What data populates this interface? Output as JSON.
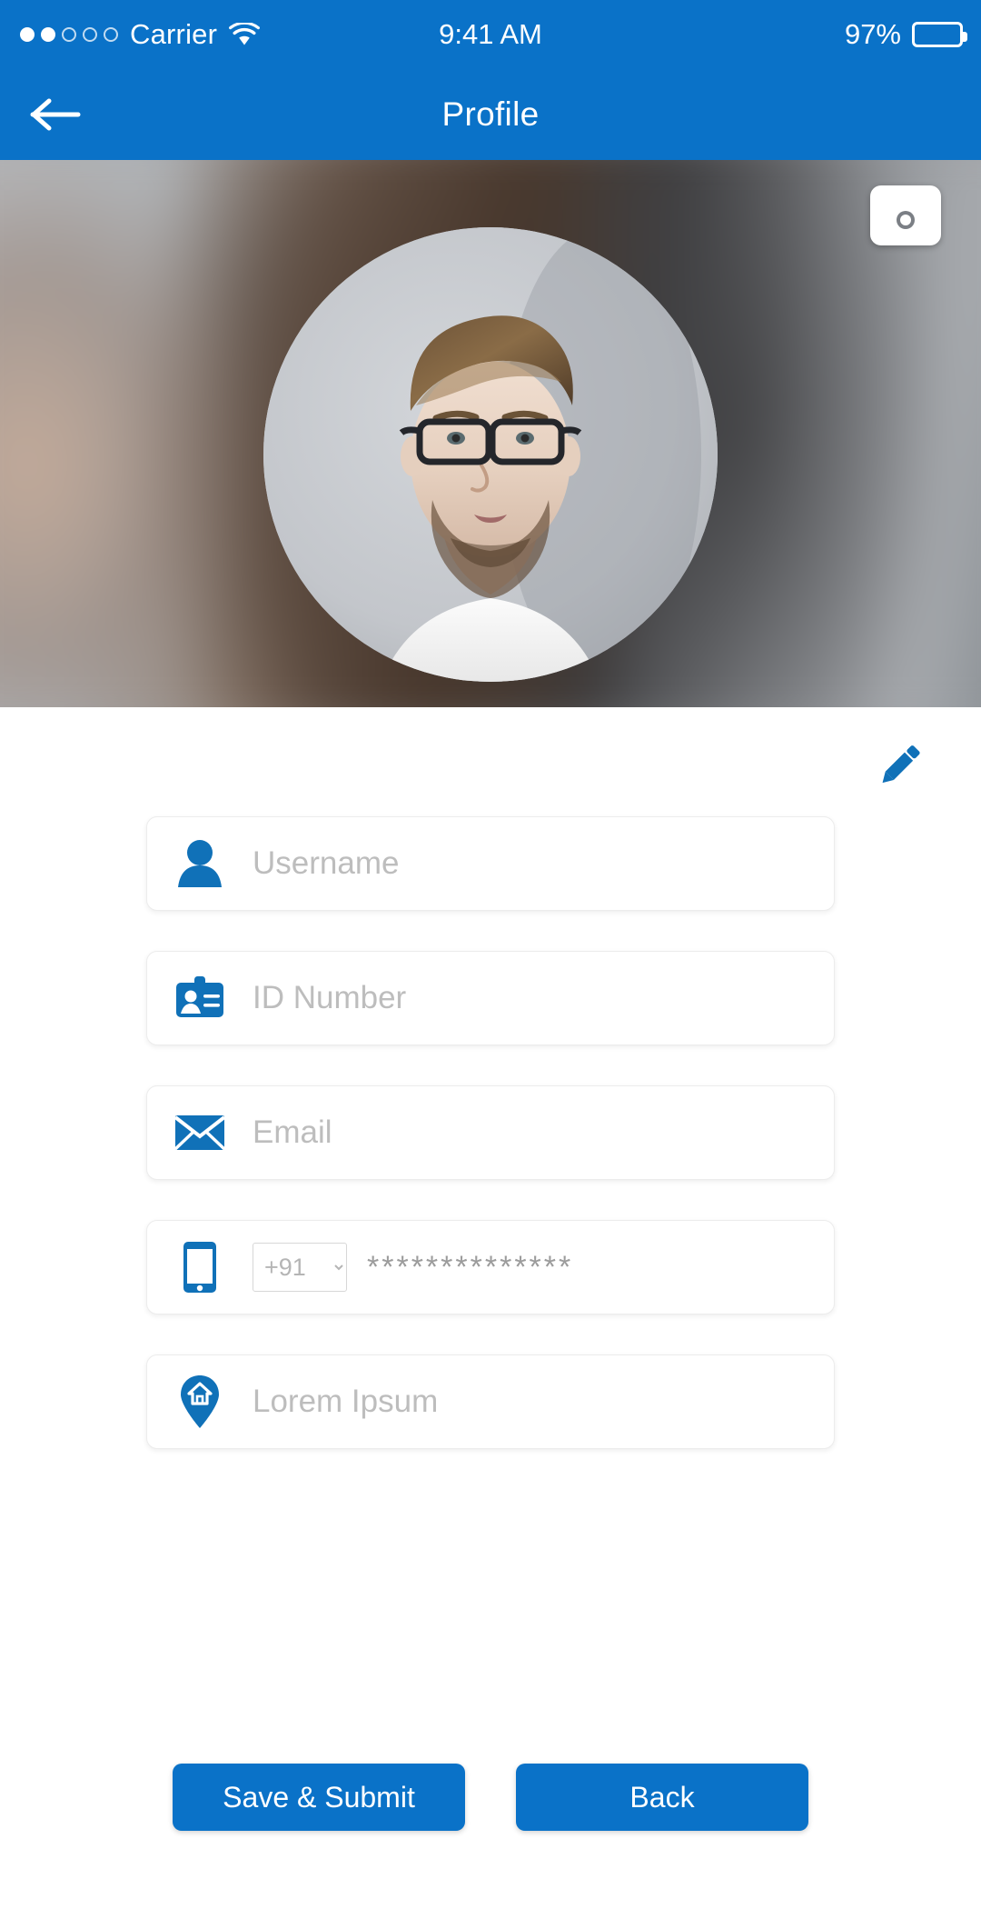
{
  "status_bar": {
    "carrier": "Carrier",
    "signal_filled": 2,
    "signal_total": 5,
    "wifi_icon": "wifi-icon",
    "time": "9:41 AM",
    "battery_percent": "97%",
    "battery_level": 97
  },
  "nav": {
    "back_icon": "arrow-left-icon",
    "title": "Profile"
  },
  "banner": {
    "camera_icon": "camera-icon",
    "avatar_icon": "profile-avatar"
  },
  "form": {
    "edit_icon": "pencil-icon",
    "fields": [
      {
        "name": "username",
        "icon": "user-icon",
        "placeholder": "Username",
        "value": ""
      },
      {
        "name": "id-number",
        "icon": "id-card-icon",
        "placeholder": "ID Number",
        "value": ""
      },
      {
        "name": "email",
        "icon": "envelope-icon",
        "placeholder": "Email",
        "value": ""
      },
      {
        "name": "address",
        "icon": "home-pin-icon",
        "placeholder": "Lorem Ipsum",
        "value": ""
      }
    ],
    "phone": {
      "icon": "mobile-phone-icon",
      "country_code": "+91",
      "country_code_options": [
        "+91"
      ],
      "dropdown_icon": "chevron-down-icon",
      "masked_value": "**************"
    }
  },
  "actions": {
    "save_label": "Save & Submit",
    "back_label": "Back"
  },
  "colors": {
    "brand_blue": "#0a72c8",
    "placeholder_gray": "#bdbdbd",
    "field_border": "#ececec"
  }
}
